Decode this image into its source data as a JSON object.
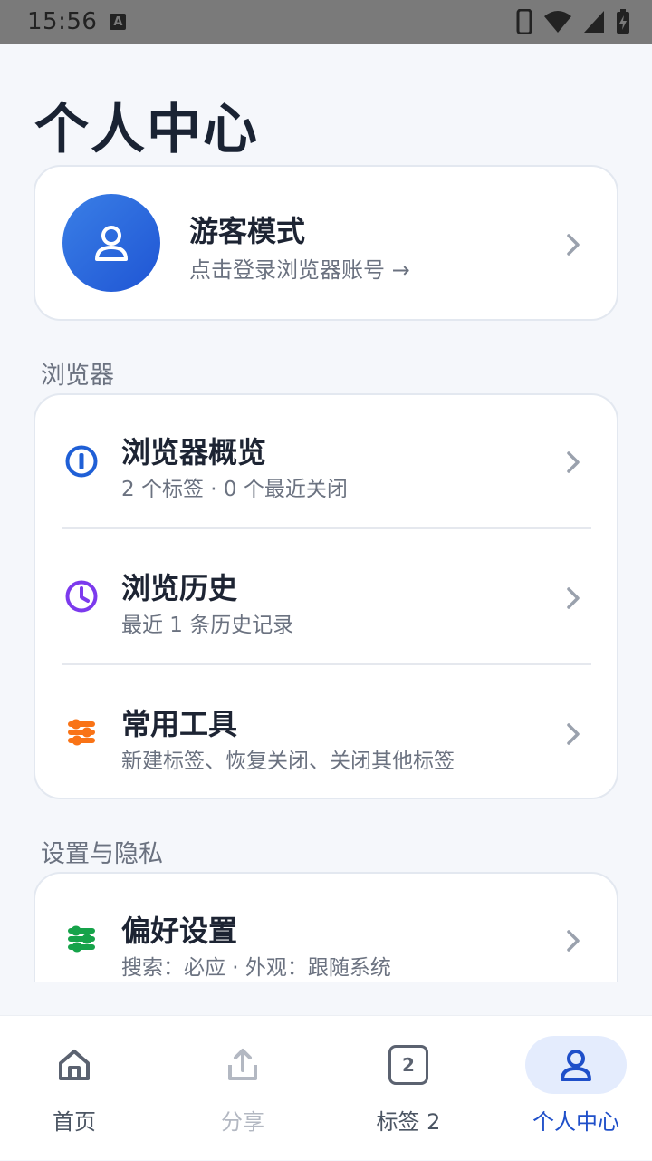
{
  "status_bar": {
    "time": "15:56",
    "indicator": "A"
  },
  "page": {
    "title": "个人中心"
  },
  "profile": {
    "name": "游客模式",
    "subtitle": "点击登录浏览器账号 →"
  },
  "sections": {
    "browser": {
      "label": "浏览器",
      "items": [
        {
          "title": "浏览器概览",
          "subtitle": "2 个标签 · 0 个最近关闭",
          "icon": "info-icon",
          "color": "#1f5fd6"
        },
        {
          "title": "浏览历史",
          "subtitle": "最近 1 条历史记录",
          "icon": "clock-icon",
          "color": "#7c3aed"
        },
        {
          "title": "常用工具",
          "subtitle": "新建标签、恢复关闭、关闭其他标签",
          "icon": "tools-icon",
          "color": "#f97316"
        }
      ]
    },
    "settings": {
      "label": "设置与隐私",
      "items": [
        {
          "title": "偏好设置",
          "subtitle": "搜索：必应 · 外观：跟随系统",
          "icon": "settings-sliders-icon",
          "color": "#16a34a"
        }
      ]
    }
  },
  "bottom_nav": {
    "items": [
      {
        "label": "首页",
        "icon": "home-icon"
      },
      {
        "label": "分享",
        "icon": "share-icon"
      },
      {
        "label": "标签 2",
        "icon": "tabs-icon",
        "tab_count": "2"
      },
      {
        "label": "个人中心",
        "icon": "person-icon"
      }
    ],
    "active_color": "#1f4fc9"
  }
}
